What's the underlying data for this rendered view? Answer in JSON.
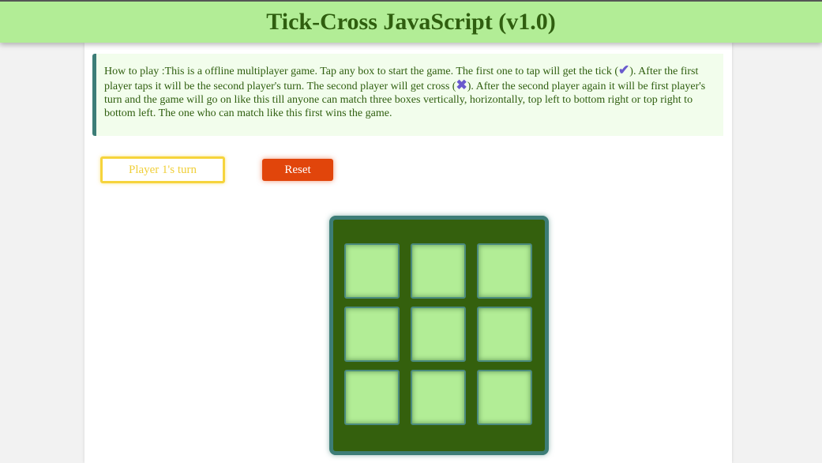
{
  "header": {
    "title": "Tick-Cross JavaScript (v1.0)"
  },
  "instructions": {
    "part1": "How to play :This is a offline multiplayer game. Tap any box to start the game. The first one to tap will get the tick (",
    "tick_glyph": "✔",
    "part2": "). After the first player taps it will be the second player's turn. The second player will get cross (",
    "cross_glyph": "✖",
    "part3": "). After the second player again it will be first player's turn and the game will go on like this till anyone can match three boxes vertically, horizontally, top left to bottom right or top right to bottom left. The one who can match like this first wins the game."
  },
  "controls": {
    "turn_label": "Player 1's turn",
    "reset_label": "Reset"
  },
  "board": {
    "cells": [
      "",
      "",
      "",
      "",
      "",
      "",
      "",
      "",
      ""
    ]
  },
  "colors": {
    "header_bg": "#b2ed96",
    "title": "#2f5e0f",
    "board_bg": "#34600d",
    "board_border": "#3d7d77",
    "cell_bg": "#b2ed96",
    "turn_accent": "#f6d43c",
    "reset_bg": "#e1450b",
    "glyph": "#6a5acd"
  },
  "icons": {
    "tick": "tick-icon",
    "cross": "cross-icon"
  }
}
